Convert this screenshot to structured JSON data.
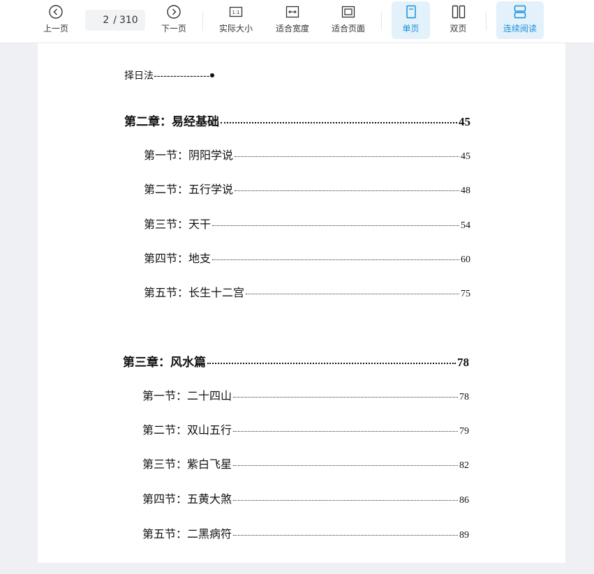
{
  "toolbar": {
    "prev_label": "上一页",
    "next_label": "下一页",
    "current_page": "2",
    "total_pages": "310",
    "page_separator": "/",
    "actual_size_label": "实际大小",
    "actual_size_glyph": "1:1",
    "fit_width_label": "适合宽度",
    "fit_page_label": "适合页面",
    "single_page_label": "单页",
    "double_page_label": "双页",
    "continuous_label": "连续阅读",
    "accent_color": "#1a8fd6"
  },
  "document": {
    "first_line": {
      "title": "择日法",
      "dashes": "-----------------"
    },
    "entries": [
      {
        "kind": "chapter",
        "title": "第二章：易经基础",
        "page": "45"
      },
      {
        "kind": "section",
        "title": "第一节：阴阳学说",
        "page": "45"
      },
      {
        "kind": "section",
        "title": "第二节：五行学说",
        "page": "48"
      },
      {
        "kind": "section",
        "title": "第三节：天干",
        "page": "54"
      },
      {
        "kind": "section",
        "title": "第四节：地支",
        "page": "60"
      },
      {
        "kind": "section",
        "title": "第五节：长生十二宫",
        "page": "75"
      },
      {
        "kind": "chapter",
        "title": "第三章：风水篇",
        "page": "78"
      },
      {
        "kind": "section",
        "title": "第一节：二十四山",
        "page": "78"
      },
      {
        "kind": "section",
        "title": "第二节：双山五行",
        "page": "79"
      },
      {
        "kind": "section",
        "title": "第三节：紫白飞星",
        "page": "82"
      },
      {
        "kind": "section",
        "title": "第四节：五黄大煞",
        "page": "86"
      },
      {
        "kind": "section",
        "title": "第五节：二黑病符",
        "page": "89"
      }
    ]
  }
}
